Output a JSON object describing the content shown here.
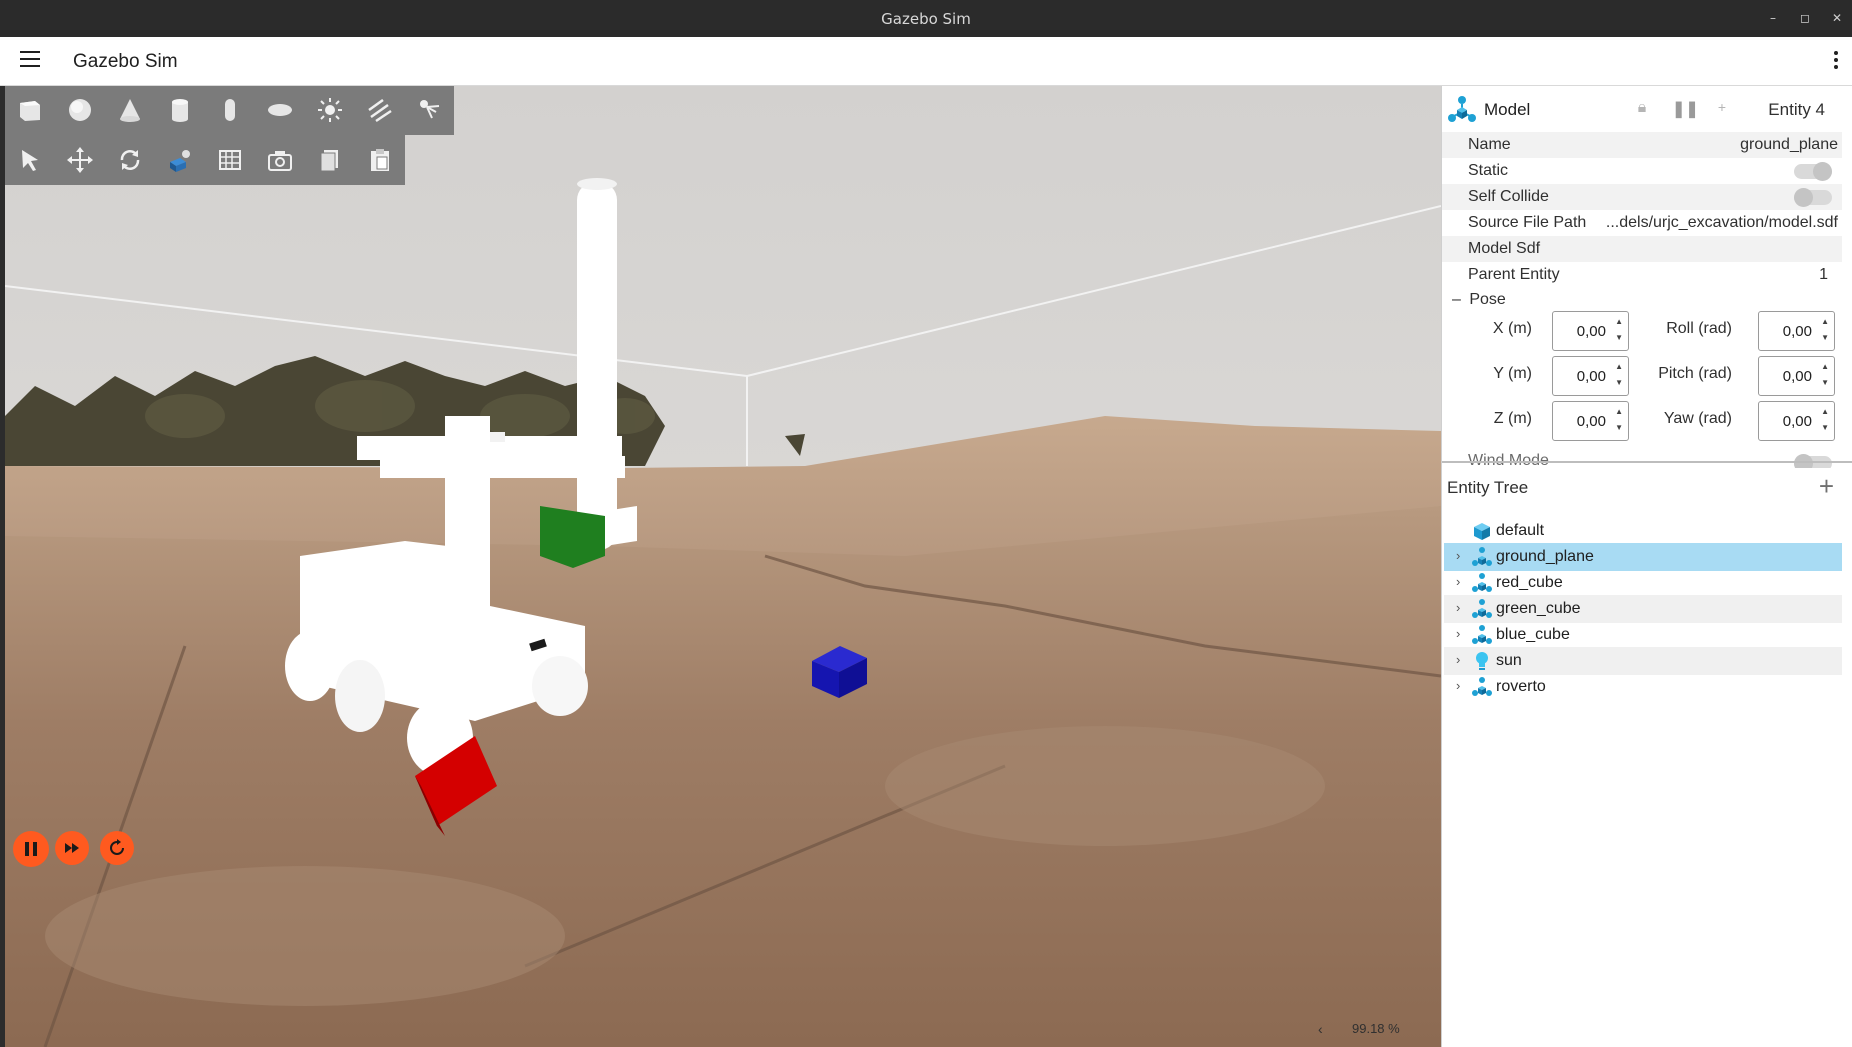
{
  "window": {
    "title": "Gazebo Sim"
  },
  "header": {
    "title": "Gazebo Sim"
  },
  "shape_tools": [
    {
      "icon": "box-icon"
    },
    {
      "icon": "sphere-icon"
    },
    {
      "icon": "cone-icon"
    },
    {
      "icon": "cylinder-icon"
    },
    {
      "icon": "capsule-icon"
    },
    {
      "icon": "ellipsoid-icon"
    },
    {
      "icon": "sun-light-icon"
    },
    {
      "icon": "directional-light-icon"
    },
    {
      "icon": "spot-light-icon"
    }
  ],
  "transform_tools": [
    {
      "icon": "select-arrow-icon"
    },
    {
      "icon": "translate-icon"
    },
    {
      "icon": "rotate-icon"
    },
    {
      "icon": "view-angle-icon"
    },
    {
      "icon": "grid-icon"
    },
    {
      "icon": "camera-icon"
    },
    {
      "icon": "copy-icon"
    },
    {
      "icon": "paste-icon"
    }
  ],
  "status": {
    "real_time_factor": "99.18 %",
    "collapse_arrow": "‹"
  },
  "component_inspector": {
    "type_label": "Model",
    "entity_label": "Entity 4",
    "properties": [
      {
        "label": "Name",
        "value": "ground_plane"
      },
      {
        "label": "Static",
        "toggle": true
      },
      {
        "label": "Self Collide",
        "toggle": false
      },
      {
        "label": "Source File Path",
        "value": "...dels/urjc_excavation/model.sdf"
      },
      {
        "label": "Model Sdf",
        "value": ""
      },
      {
        "label": "Parent Entity",
        "value": "1"
      }
    ],
    "pose": {
      "header": "Pose",
      "collapse_symbol": "–",
      "x_label": "X (m)",
      "x_value": "0,00",
      "y_label": "Y (m)",
      "y_value": "0,00",
      "z_label": "Z (m)",
      "z_value": "0,00",
      "roll_label": "Roll (rad)",
      "roll_value": "0,00",
      "pitch_label": "Pitch (rad)",
      "pitch_value": "0,00",
      "yaw_label": "Yaw (rad)",
      "yaw_value": "0,00"
    },
    "wind_mode_label": "Wind Mode"
  },
  "entity_tree": {
    "title": "Entity Tree",
    "items": [
      {
        "label": "default",
        "icon": "world-cube-icon"
      },
      {
        "label": "ground_plane",
        "icon": "model-icon",
        "selected": true
      },
      {
        "label": "red_cube",
        "icon": "model-icon"
      },
      {
        "label": "green_cube",
        "icon": "model-icon"
      },
      {
        "label": "blue_cube",
        "icon": "model-icon"
      },
      {
        "label": "sun",
        "icon": "light-bulb-icon"
      },
      {
        "label": "roverto",
        "icon": "model-icon"
      }
    ]
  },
  "colors": {
    "accent": "#ff5a1f",
    "selection": "#a8dbf3",
    "toolbar": "#7b7b7b"
  }
}
